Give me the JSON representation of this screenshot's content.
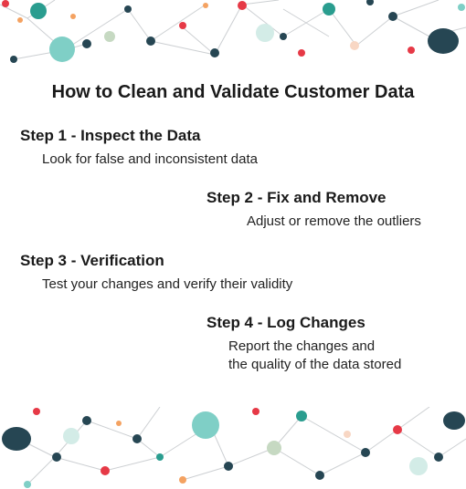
{
  "title": "How to Clean and Validate Customer Data",
  "steps": [
    {
      "head": "Step 1 - Inspect the Data",
      "body": "Look for false and inconsistent data"
    },
    {
      "head": "Step 2 - Fix and Remove",
      "body": "Adjust or remove the outliers"
    },
    {
      "head": "Step 3 - Verification",
      "body": "Test your changes and verify their validity"
    },
    {
      "head": "Step 4 - Log Changes",
      "body": "Report the changes and\nthe quality of the data stored"
    }
  ],
  "palette": {
    "navy": "#264653",
    "teal": "#2a9d8f",
    "tealLight": "#7fcfc6",
    "mint": "#d3ece7",
    "red": "#e63946",
    "orange": "#f4a261",
    "peach": "#f8d7c4",
    "sage": "#c6d9c2",
    "line": "#9aa0a6"
  }
}
